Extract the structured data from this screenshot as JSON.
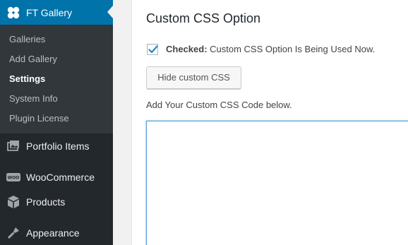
{
  "sidebar": {
    "active_menu": {
      "label": "FT Gallery",
      "icon": "ft-gallery-icon"
    },
    "submenu": [
      {
        "label": "Galleries"
      },
      {
        "label": "Add Gallery"
      },
      {
        "label": "Settings",
        "current": true
      },
      {
        "label": "System Info"
      },
      {
        "label": "Plugin License"
      }
    ],
    "menu": [
      {
        "label": "Portfolio Items",
        "icon": "portfolio-icon"
      },
      {
        "label": "WooCommerce",
        "icon": "woocommerce-icon"
      },
      {
        "label": "Products",
        "icon": "products-icon"
      },
      {
        "label": "Appearance",
        "icon": "appearance-icon"
      }
    ]
  },
  "main": {
    "title": "Custom CSS Option",
    "checkbox": {
      "checked": true,
      "bold_text": "Checked:",
      "text": " Custom CSS Option Is Being Used Now."
    },
    "hide_button_label": "Hide custom CSS",
    "textarea_label": "Add Your Custom CSS Code below.",
    "textarea_value": ""
  },
  "colors": {
    "admin_bar": "#23282d",
    "submenu_bg": "#32373c",
    "accent": "#0073aa"
  }
}
